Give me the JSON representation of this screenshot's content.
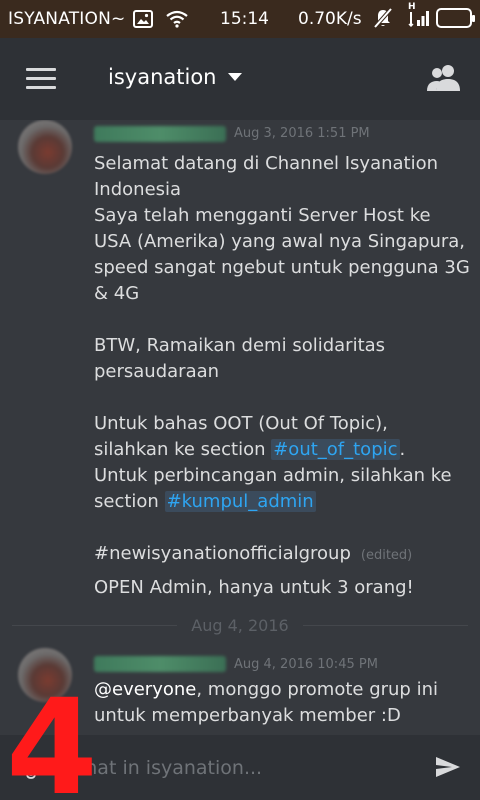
{
  "status_bar": {
    "carrier": "ISYANATION~",
    "time": "15:14",
    "network_speed": "0.70K/s",
    "network_type": "H",
    "battery_level": 1.0,
    "icons": [
      "image-icon",
      "wifi-icon",
      "mute-icon",
      "signal-icon",
      "battery-icon"
    ],
    "battery_color": "#3ddc37"
  },
  "toolbar": {
    "menu_icon": "hamburger-icon",
    "server_name": "isyanation",
    "dropdown_icon": "caret-down-icon",
    "members_icon": "members-icon"
  },
  "messages": [
    {
      "timestamp": "Aug 3, 2016 1:51 PM",
      "lines": [
        "Selamat datang di Channel Isyanation",
        "Indonesia",
        "Saya telah mengganti Server Host ke",
        "USA (Amerika) yang awal nya Singapura,",
        "speed sangat ngebut untuk pengguna 3G",
        "& 4G",
        "",
        "BTW, Ramaikan demi solidaritas",
        "persaudaraan",
        "",
        "Untuk bahas OOT (Out Of Topic),"
      ],
      "line11_prefix": "silahkan ke section ",
      "channel_link_1": "#out_of_topic",
      "line11_suffix": ".",
      "line12": "Untuk perbincangan admin, silahkan ke",
      "line13_prefix": "section ",
      "channel_link_2": "#kumpul_admin",
      "hashtag_line": "#newisyanationofficialgroup",
      "edited_label": "(edited)",
      "final_line": "OPEN Admin, hanya untuk 3 orang!"
    },
    {
      "timestamp": "Aug 4, 2016 10:45 PM",
      "mention": "@everyone",
      "line1_suffix": ", monggo promote grup ini",
      "line2": "untuk memperbanyak member :D"
    }
  ],
  "date_divider": "Aug 4, 2016",
  "composer": {
    "placeholder": "Chat in isyanation...",
    "attach_icon": "paperclip-icon",
    "send_icon": "send-icon"
  },
  "overlay_number": "4",
  "colors": {
    "background": "#36393e",
    "toolbar": "#2e3136",
    "link": "#2ea5f2",
    "overlay": "#ff1a1a"
  }
}
